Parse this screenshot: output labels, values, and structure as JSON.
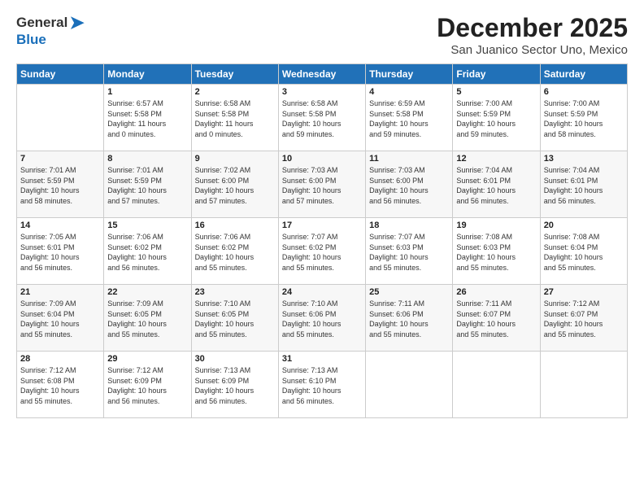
{
  "logo": {
    "text_general": "General",
    "text_blue": "Blue"
  },
  "title": "December 2025",
  "subtitle": "San Juanico Sector Uno, Mexico",
  "header_days": [
    "Sunday",
    "Monday",
    "Tuesday",
    "Wednesday",
    "Thursday",
    "Friday",
    "Saturday"
  ],
  "weeks": [
    [
      {
        "day": "",
        "info": ""
      },
      {
        "day": "1",
        "info": "Sunrise: 6:57 AM\nSunset: 5:58 PM\nDaylight: 11 hours\nand 0 minutes."
      },
      {
        "day": "2",
        "info": "Sunrise: 6:58 AM\nSunset: 5:58 PM\nDaylight: 11 hours\nand 0 minutes."
      },
      {
        "day": "3",
        "info": "Sunrise: 6:58 AM\nSunset: 5:58 PM\nDaylight: 10 hours\nand 59 minutes."
      },
      {
        "day": "4",
        "info": "Sunrise: 6:59 AM\nSunset: 5:58 PM\nDaylight: 10 hours\nand 59 minutes."
      },
      {
        "day": "5",
        "info": "Sunrise: 7:00 AM\nSunset: 5:59 PM\nDaylight: 10 hours\nand 59 minutes."
      },
      {
        "day": "6",
        "info": "Sunrise: 7:00 AM\nSunset: 5:59 PM\nDaylight: 10 hours\nand 58 minutes."
      }
    ],
    [
      {
        "day": "7",
        "info": "Sunrise: 7:01 AM\nSunset: 5:59 PM\nDaylight: 10 hours\nand 58 minutes."
      },
      {
        "day": "8",
        "info": "Sunrise: 7:01 AM\nSunset: 5:59 PM\nDaylight: 10 hours\nand 57 minutes."
      },
      {
        "day": "9",
        "info": "Sunrise: 7:02 AM\nSunset: 6:00 PM\nDaylight: 10 hours\nand 57 minutes."
      },
      {
        "day": "10",
        "info": "Sunrise: 7:03 AM\nSunset: 6:00 PM\nDaylight: 10 hours\nand 57 minutes."
      },
      {
        "day": "11",
        "info": "Sunrise: 7:03 AM\nSunset: 6:00 PM\nDaylight: 10 hours\nand 56 minutes."
      },
      {
        "day": "12",
        "info": "Sunrise: 7:04 AM\nSunset: 6:01 PM\nDaylight: 10 hours\nand 56 minutes."
      },
      {
        "day": "13",
        "info": "Sunrise: 7:04 AM\nSunset: 6:01 PM\nDaylight: 10 hours\nand 56 minutes."
      }
    ],
    [
      {
        "day": "14",
        "info": "Sunrise: 7:05 AM\nSunset: 6:01 PM\nDaylight: 10 hours\nand 56 minutes."
      },
      {
        "day": "15",
        "info": "Sunrise: 7:06 AM\nSunset: 6:02 PM\nDaylight: 10 hours\nand 56 minutes."
      },
      {
        "day": "16",
        "info": "Sunrise: 7:06 AM\nSunset: 6:02 PM\nDaylight: 10 hours\nand 55 minutes."
      },
      {
        "day": "17",
        "info": "Sunrise: 7:07 AM\nSunset: 6:02 PM\nDaylight: 10 hours\nand 55 minutes."
      },
      {
        "day": "18",
        "info": "Sunrise: 7:07 AM\nSunset: 6:03 PM\nDaylight: 10 hours\nand 55 minutes."
      },
      {
        "day": "19",
        "info": "Sunrise: 7:08 AM\nSunset: 6:03 PM\nDaylight: 10 hours\nand 55 minutes."
      },
      {
        "day": "20",
        "info": "Sunrise: 7:08 AM\nSunset: 6:04 PM\nDaylight: 10 hours\nand 55 minutes."
      }
    ],
    [
      {
        "day": "21",
        "info": "Sunrise: 7:09 AM\nSunset: 6:04 PM\nDaylight: 10 hours\nand 55 minutes."
      },
      {
        "day": "22",
        "info": "Sunrise: 7:09 AM\nSunset: 6:05 PM\nDaylight: 10 hours\nand 55 minutes."
      },
      {
        "day": "23",
        "info": "Sunrise: 7:10 AM\nSunset: 6:05 PM\nDaylight: 10 hours\nand 55 minutes."
      },
      {
        "day": "24",
        "info": "Sunrise: 7:10 AM\nSunset: 6:06 PM\nDaylight: 10 hours\nand 55 minutes."
      },
      {
        "day": "25",
        "info": "Sunrise: 7:11 AM\nSunset: 6:06 PM\nDaylight: 10 hours\nand 55 minutes."
      },
      {
        "day": "26",
        "info": "Sunrise: 7:11 AM\nSunset: 6:07 PM\nDaylight: 10 hours\nand 55 minutes."
      },
      {
        "day": "27",
        "info": "Sunrise: 7:12 AM\nSunset: 6:07 PM\nDaylight: 10 hours\nand 55 minutes."
      }
    ],
    [
      {
        "day": "28",
        "info": "Sunrise: 7:12 AM\nSunset: 6:08 PM\nDaylight: 10 hours\nand 55 minutes."
      },
      {
        "day": "29",
        "info": "Sunrise: 7:12 AM\nSunset: 6:09 PM\nDaylight: 10 hours\nand 56 minutes."
      },
      {
        "day": "30",
        "info": "Sunrise: 7:13 AM\nSunset: 6:09 PM\nDaylight: 10 hours\nand 56 minutes."
      },
      {
        "day": "31",
        "info": "Sunrise: 7:13 AM\nSunset: 6:10 PM\nDaylight: 10 hours\nand 56 minutes."
      },
      {
        "day": "",
        "info": ""
      },
      {
        "day": "",
        "info": ""
      },
      {
        "day": "",
        "info": ""
      }
    ]
  ]
}
